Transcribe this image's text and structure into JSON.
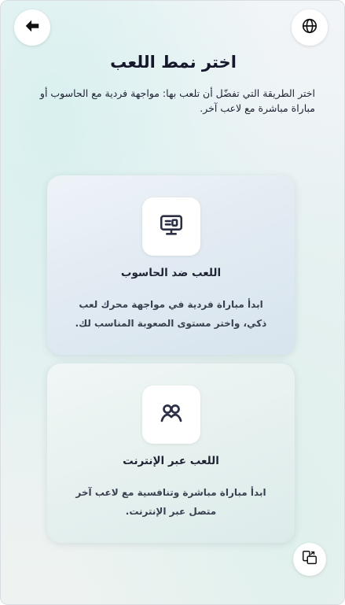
{
  "header": {
    "title": "اختر نمط اللعب",
    "subtitle": "اختر الطريقة التي تفضّل أن تلعب بها: مواجهة فردية مع الحاسوب أو مباراة مباشرة مع لاعب آخر."
  },
  "icons": {
    "back": "arrow-left-icon",
    "language": "globe-icon",
    "computer": "monitor-icon",
    "online": "users-icon",
    "switch": "device-switch-icon"
  },
  "modes": [
    {
      "title": "اللعب ضد الحاسوب",
      "description": "ابدأ مباراة فردية في مواجهة محرك لعب ذكي، واختر مستوى الصعوبة المناسب لك."
    },
    {
      "title": "اللعب عبر الإنترنت",
      "description": "ابدأ مباراة مباشرة وتنافسية مع لاعب آخر متصل عبر الإنترنت."
    }
  ],
  "colors": {
    "text_dark": "#14182a",
    "icon_dark": "#2b2f45"
  }
}
